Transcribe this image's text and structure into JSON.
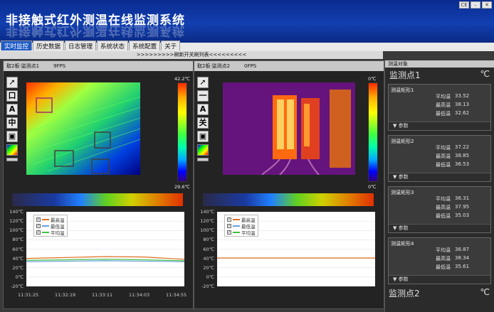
{
  "app": {
    "title": "非接触式红外测温在线监测系统"
  },
  "window": {
    "controls": [
      "CE",
      "–",
      "✕"
    ]
  },
  "menu": {
    "items": [
      "实时监控",
      "历史数据",
      "日志管理",
      "系统状态",
      "系统配置",
      "关于"
    ]
  },
  "marquee": {
    "text": ">>>>>>>>>刷新开关刷列表<<<<<<<<<"
  },
  "panels": [
    {
      "title": "取2板·监测点1",
      "fps": "9FPS",
      "temp_max": "42.2℃",
      "temp_min": "29.6℃",
      "tools": [
        "pointer",
        "rect",
        "A",
        "中",
        "save",
        "palette"
      ],
      "tool_labels": [
        "",
        "口",
        "A",
        "中",
        "",
        ""
      ],
      "legend": [
        "最高温",
        "最低温",
        "平均温"
      ],
      "y_ticks": [
        "140℃",
        "120℃",
        "100℃",
        "80℃",
        "60℃",
        "40℃",
        "20℃",
        "0℃",
        "-20℃"
      ],
      "x_ticks": [
        "11:31:25",
        "11:32:19",
        "11:33:11",
        "11:34:03",
        "11:34:55"
      ]
    },
    {
      "title": "取2板·监测点2",
      "fps": "0FPS",
      "temp_max": "0℃",
      "temp_min": "0℃",
      "tools": [
        "pointer",
        "line",
        "A",
        "关",
        "save",
        "palette"
      ],
      "tool_labels": [
        "",
        "一",
        "A",
        "关",
        "",
        ""
      ],
      "legend": [
        "最高温",
        "最低温",
        "平均温"
      ],
      "y_ticks": [
        "140℃",
        "120℃",
        "100℃",
        "80℃",
        "60℃",
        "40℃",
        "20℃",
        "0℃",
        "-20℃"
      ],
      "x_ticks": []
    }
  ],
  "sidebar": {
    "header": "测温对象",
    "point1": {
      "name": "监测点1",
      "unit": "℃"
    },
    "point2": {
      "name": "监测点2",
      "unit": "℃"
    },
    "param_label": "参数",
    "rects": [
      {
        "name": "测温矩形1",
        "avg_label": "平均温",
        "avg": "33.52",
        "max_label": "最高温",
        "max": "38.13",
        "min_label": "最低温",
        "min": "32.62"
      },
      {
        "name": "测温矩形2",
        "avg_label": "平均温",
        "avg": "37.22",
        "max_label": "最高温",
        "max": "38.85",
        "min_label": "最低温",
        "min": "36.53"
      },
      {
        "name": "测温矩形3",
        "avg_label": "平均温",
        "avg": "36.31",
        "max_label": "最高温",
        "max": "37.95",
        "min_label": "最低温",
        "min": "35.03"
      },
      {
        "name": "测温矩形4",
        "avg_label": "平均温",
        "avg": "36.87",
        "max_label": "最高温",
        "max": "38.34",
        "min_label": "最低温",
        "min": "35.61"
      }
    ]
  },
  "colors": {
    "max": "#e07020",
    "min": "#6aa0e0",
    "avg": "#40c040",
    "header_blue": "#0a2b8f"
  },
  "chart_data": [
    {
      "type": "line",
      "x": [
        "11:31:25",
        "11:32:19",
        "11:33:11",
        "11:34:03",
        "11:34:55"
      ],
      "ylim": [
        -20,
        140
      ],
      "series": [
        {
          "name": "最高温",
          "values": [
            40,
            42,
            44,
            43,
            38
          ]
        },
        {
          "name": "最低温",
          "values": [
            33,
            34,
            35,
            34,
            33
          ]
        },
        {
          "name": "平均温",
          "values": [
            36,
            37,
            38,
            37,
            35
          ]
        }
      ]
    },
    {
      "type": "line",
      "ylim": [
        -20,
        140
      ],
      "series": [
        {
          "name": "最高温",
          "values": [
            41,
            41,
            41,
            41,
            41
          ]
        }
      ]
    }
  ]
}
